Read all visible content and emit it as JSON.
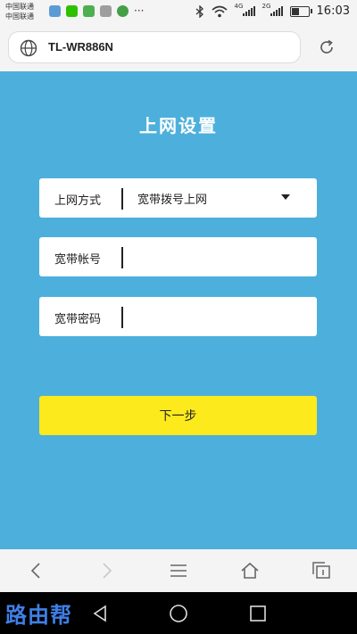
{
  "status_bar": {
    "carrier_1": "中国联通",
    "carrier_2": "中国联通",
    "more": "···",
    "net_1": "4G",
    "net_2": "2G",
    "time": "16:03",
    "battery_level": 0.55
  },
  "browser": {
    "url": "TL-WR886N"
  },
  "page": {
    "title": "上网设置",
    "fields": [
      {
        "label": "上网方式",
        "value": "宽带拨号上网"
      },
      {
        "label": "宽带帐号",
        "value": ""
      },
      {
        "label": "宽带密码",
        "value": ""
      }
    ],
    "next_button": "下一步"
  },
  "watermark": "路由帮",
  "colors": {
    "background": "#4db0dc",
    "button": "#fcea1c",
    "bar": "#f4f4f4"
  }
}
